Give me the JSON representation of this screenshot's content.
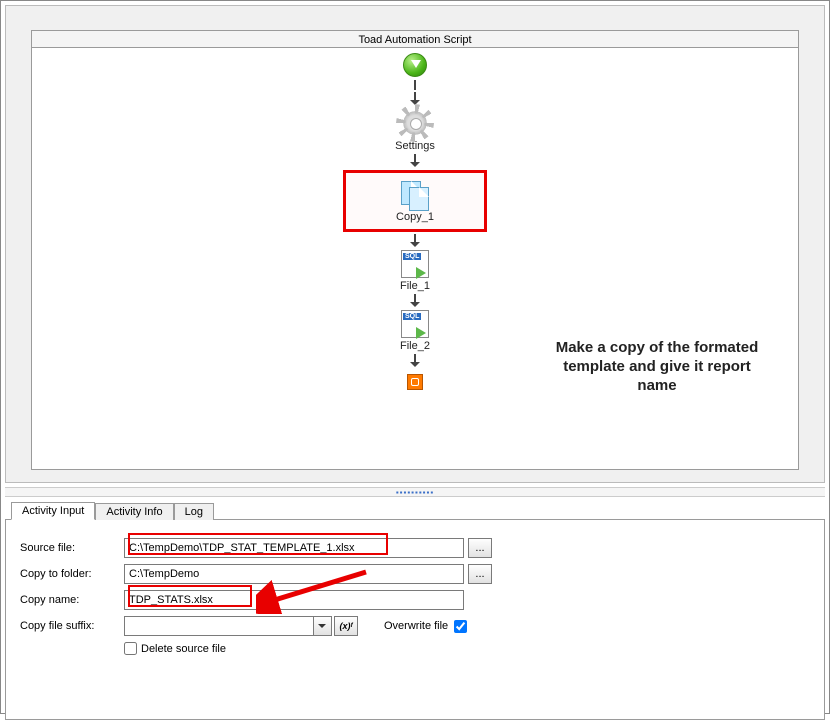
{
  "canvas": {
    "title": "Toad Automation Script",
    "nodes": {
      "settings": "Settings",
      "copy": "Copy_1",
      "file1": "File_1",
      "file2": "File_2"
    }
  },
  "annotation": "Make a copy of the formated template and give it report name",
  "tabs": {
    "activity_input": "Activity Input",
    "activity_info": "Activity Info",
    "log": "Log"
  },
  "form": {
    "source_file_label": "Source file:",
    "source_file_value": "C:\\TempDemo\\TDP_STAT_TEMPLATE_1.xlsx",
    "copy_to_label": "Copy to folder:",
    "copy_to_value": "C:\\TempDemo",
    "copy_name_label": "Copy name:",
    "copy_name_value": "TDP_STATS.xlsx",
    "suffix_label": "Copy file suffix:",
    "suffix_value": "",
    "overwrite_label": "Overwrite file",
    "overwrite_checked": true,
    "delete_label": "Delete source file",
    "delete_checked": false,
    "browse_label": "...",
    "xf_label": "(x)ᶠ"
  }
}
